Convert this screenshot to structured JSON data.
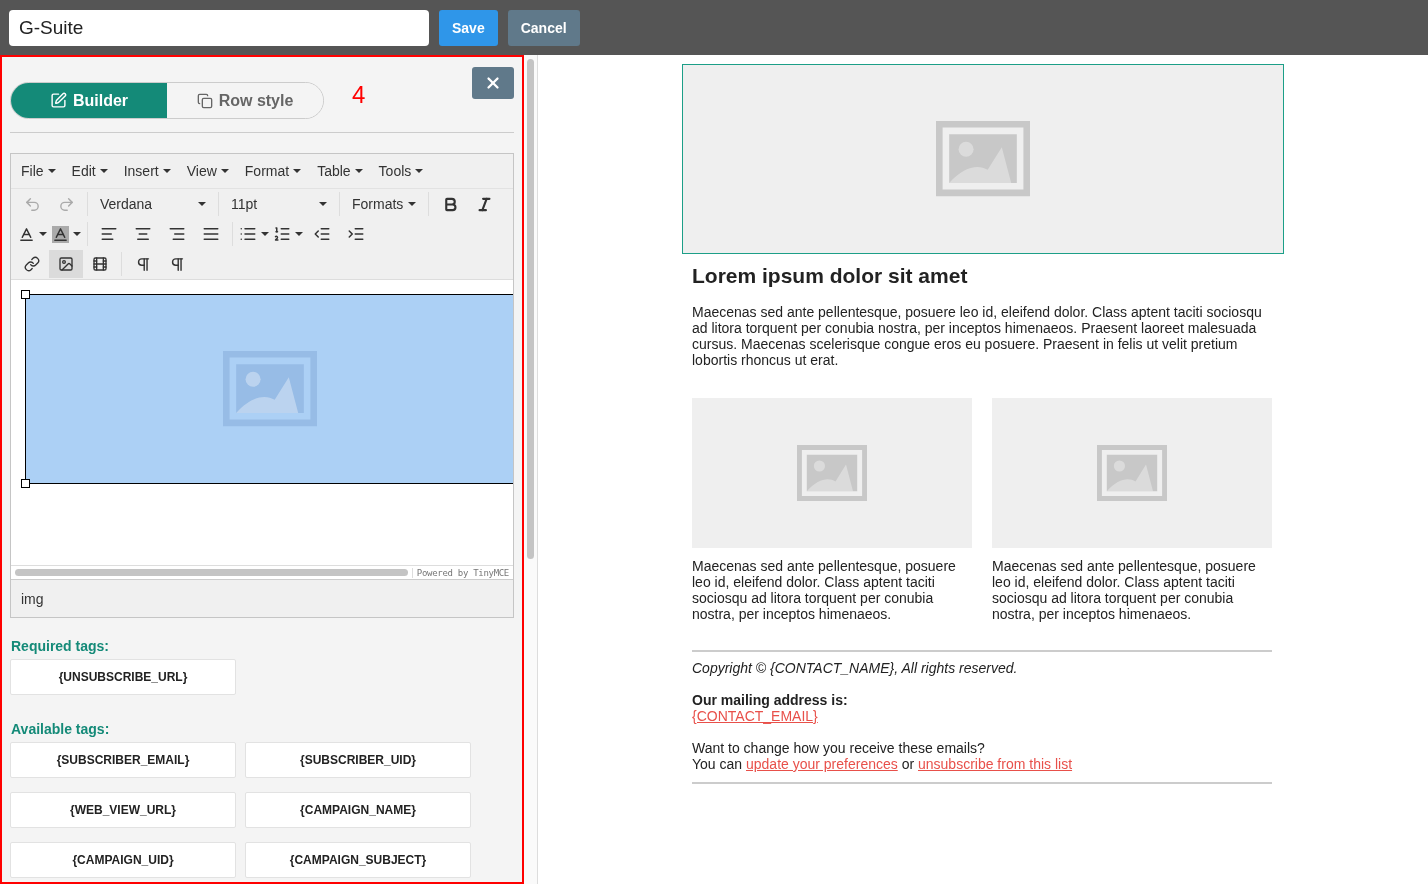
{
  "header": {
    "name_value": "G-Suite",
    "buttons": [
      {
        "label": "Save",
        "kind": "primary"
      },
      {
        "label": "Cancel",
        "kind": "secondary"
      }
    ]
  },
  "panel": {
    "annotation": "4",
    "tabs": [
      {
        "label": "Builder",
        "kind": "builder",
        "selected": true
      },
      {
        "label": "Row style",
        "kind": "rowstyle",
        "selected": false
      }
    ],
    "editor": {
      "menus": [
        "File",
        "Edit",
        "Insert",
        "View",
        "Format",
        "Table",
        "Tools"
      ],
      "font": "Verdana",
      "size": "11pt",
      "formats": "Formats",
      "insert_tools": [
        {
          "kind": "link",
          "selected": false
        },
        {
          "kind": "image",
          "selected": true
        },
        {
          "kind": "media",
          "selected": false
        }
      ],
      "branding": "Powered by TinyMCE",
      "status_path": "img"
    },
    "required_title": "Required tags:",
    "required_tags": [
      "{UNSUBSCRIBE_URL}"
    ],
    "available_title": "Available tags:",
    "available_tags": [
      "{SUBSCRIBER_EMAIL}",
      "{SUBSCRIBER_UID}",
      "{WEB_VIEW_URL}",
      "{CAMPAIGN_NAME}",
      "{CAMPAIGN_UID}",
      "{CAMPAIGN_SUBJECT}"
    ]
  },
  "preview": {
    "heading": "Lorem ipsum dolor sit amet",
    "intro": "Maecenas sed ante pellentesque, posuere leo id, eleifend dolor. Class aptent taciti sociosqu ad litora torquent per conubia nostra, per inceptos himenaeos. Praesent laoreet malesuada cursus. Maecenas scelerisque congue eros eu posuere. Praesent in felis ut velit pretium lobortis rhoncus ut erat.",
    "columns": [
      {
        "text": "Maecenas sed ante pellentesque, posuere leo id, eleifend dolor. Class aptent taciti sociosqu ad litora torquent per conubia nostra, per inceptos himenaeos."
      },
      {
        "text": "Maecenas sed ante pellentesque, posuere leo id, eleifend dolor. Class aptent taciti sociosqu ad litora torquent per conubia nostra, per inceptos himenaeos."
      }
    ],
    "copyright": "Copyright © {CONTACT_NAME}, All rights reserved.",
    "address_label": "Our mailing address is:",
    "address_link": "{CONTACT_EMAIL}",
    "change_text": "Want to change how you receive these emails?",
    "you_can": "You can",
    "preferences_link": "update your preferences",
    "or": "or",
    "unsubscribe_link": "unsubscribe from this list"
  }
}
